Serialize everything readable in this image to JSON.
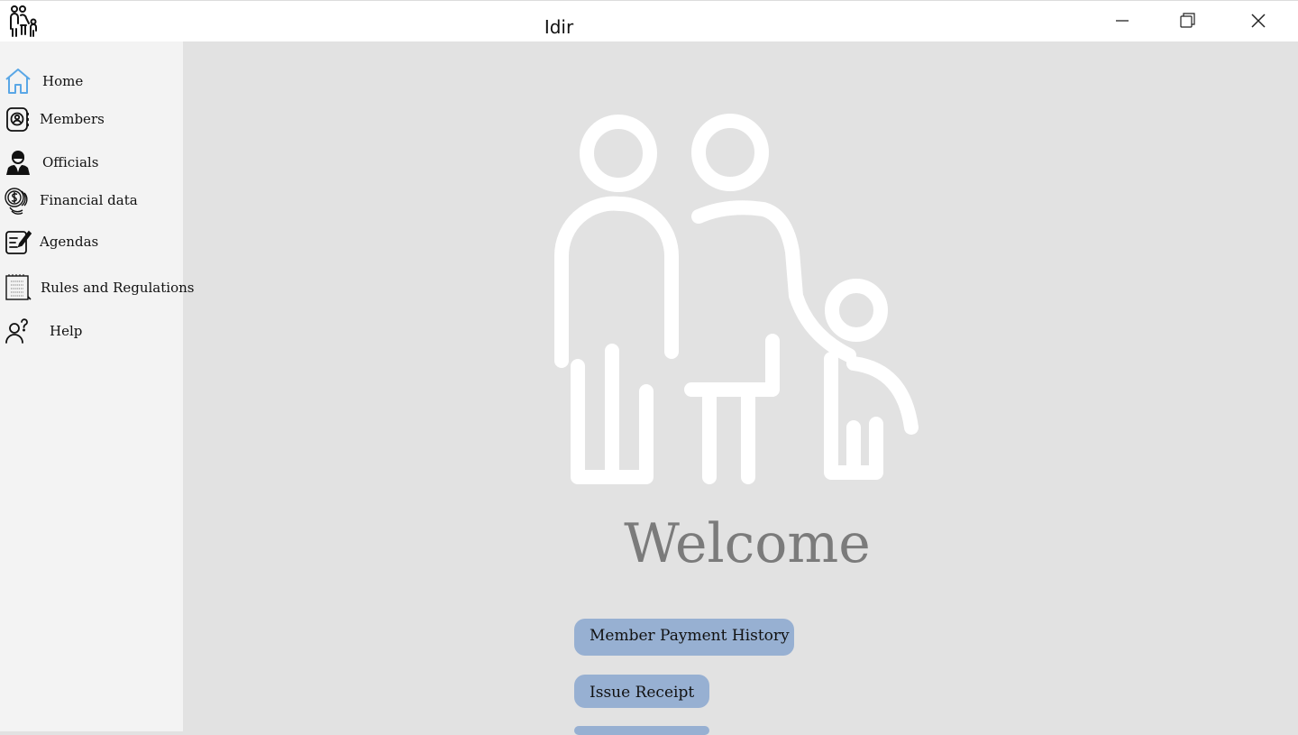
{
  "window": {
    "title": "Idir",
    "logo_icon": "family-icon",
    "controls": [
      "minimize-icon",
      "restore-icon",
      "close-icon"
    ]
  },
  "sidebar": {
    "items": [
      {
        "label": "Home",
        "icon": "home-icon",
        "active": true
      },
      {
        "label": "Members",
        "icon": "member-card-icon"
      },
      {
        "label": "Officials",
        "icon": "official-icon"
      },
      {
        "label": "Financial data",
        "icon": "coins-icon"
      },
      {
        "label": "Agendas",
        "icon": "notepad-icon"
      },
      {
        "label": "Rules and Regulations",
        "icon": "document-icon"
      },
      {
        "label": "Help",
        "icon": "help-icon"
      }
    ]
  },
  "main": {
    "hero_icon": "family-icon",
    "welcome": "Welcome",
    "buttons": {
      "payment_history": "Member Payment History",
      "issue_receipt": "Issue Receipt"
    }
  },
  "colors": {
    "titlebar": "#ffffff",
    "sidebar": "#f3f3f3",
    "main_bg": "#e2e2e2",
    "accent": "#5aa7e6",
    "button": "#97b0d2",
    "welcome_text": "#7b7b7b"
  }
}
